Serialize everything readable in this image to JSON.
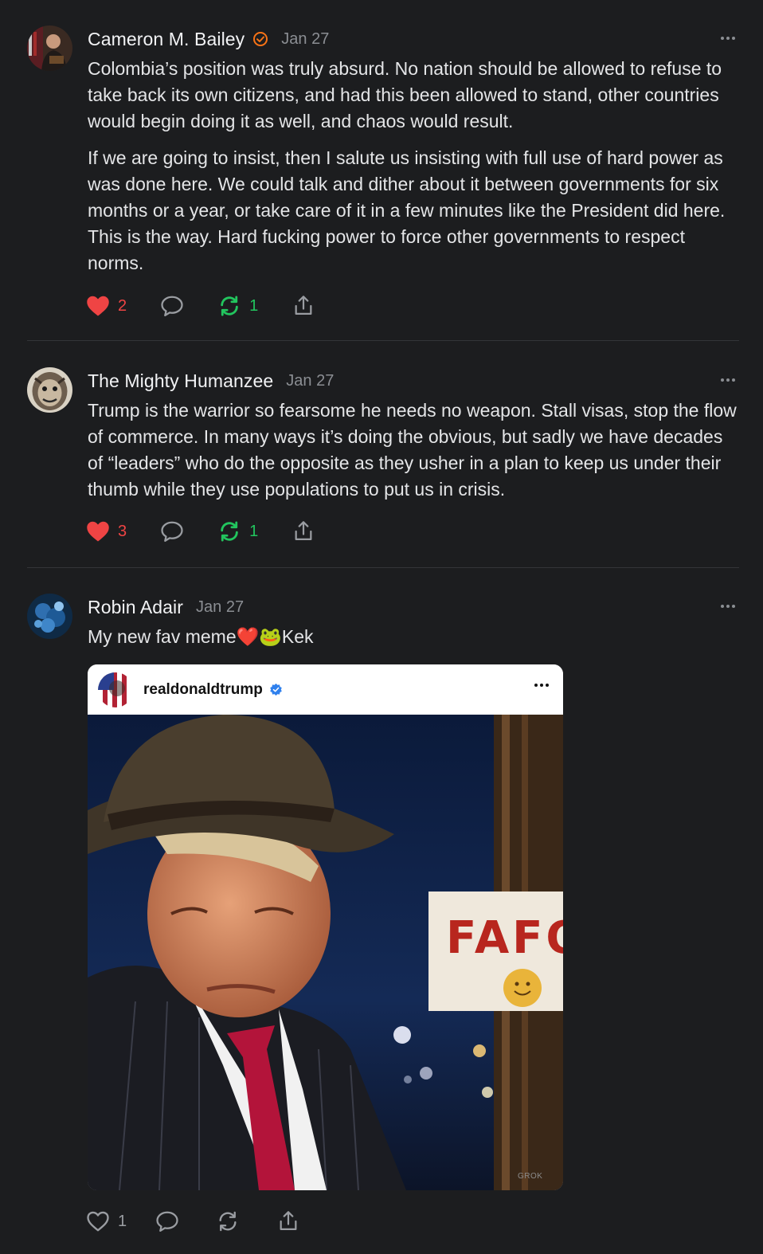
{
  "posts": [
    {
      "author": "Cameron M. Bailey",
      "verified": true,
      "date": "Jan 27",
      "paragraphs": [
        "Colombia’s position was truly absurd. No nation should be allowed to refuse to take back its own citizens, and had this been allowed to stand, other countries would begin doing it as well, and chaos would result.",
        "If we are going to insist, then I salute us insisting with full use of hard power as was done here. We could talk and dither about it between governments for six months or a year, or take care of it in a few minutes like the President did here. This is the way. Hard fucking power to force other governments to respect norms."
      ],
      "likes": "2",
      "liked": true,
      "reposts": "1",
      "reposted": true
    },
    {
      "author": "The Mighty Humanzee",
      "verified": false,
      "date": "Jan 27",
      "paragraphs": [
        "Trump is the warrior so fearsome he needs no weapon. Stall visas, stop the flow of commerce. In many ways it’s doing the obvious, but sadly we have decades of “leaders” who do the opposite as they usher in a plan to keep us under their thumb while they use populations to put us in crisis."
      ],
      "likes": "3",
      "liked": true,
      "reposts": "1",
      "reposted": true
    },
    {
      "author": "Robin Adair",
      "verified": false,
      "date": "Jan 27",
      "text": "My new fav meme❤️🐸Kek",
      "likes": "1",
      "liked": false,
      "reposts": "",
      "reposted": false,
      "embed": {
        "username": "realdonaldtrump",
        "verified": true,
        "sign_text": "FAFO",
        "watermark": "GROK"
      }
    }
  ],
  "icons": {
    "like": "heart-icon",
    "reply": "comment-icon",
    "repost": "repost-icon",
    "share": "share-icon",
    "more": "more-icon",
    "verified": "verified-badge-icon"
  },
  "colors": {
    "background": "#1c1d1f",
    "like_active": "#ef4444",
    "repost_active": "#22c55e",
    "muted": "#8b8e93",
    "verified_orange": "#f97316",
    "verified_blue": "#2f80ed"
  }
}
